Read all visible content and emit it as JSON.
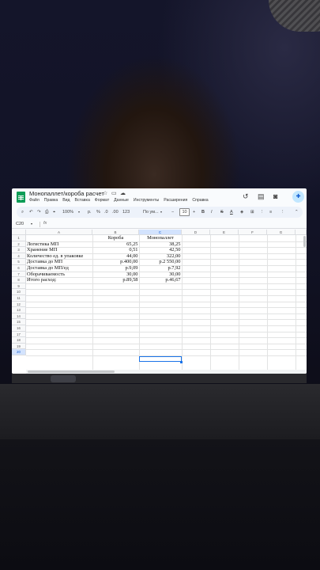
{
  "app": {
    "doc_title": "Монопаллет/короба расчет",
    "menu": [
      "Файл",
      "Правка",
      "Вид",
      "Вставка",
      "Формат",
      "Данные",
      "Инструменты",
      "Расширения",
      "Справка"
    ]
  },
  "toolbar": {
    "zoom": "100%",
    "currency": "р.",
    "percent": "%",
    "decimal_decrease": ".0",
    "decimal_increase": ".00",
    "number_format": "123",
    "font": "По ум...",
    "font_size": "10",
    "bold": "B",
    "italic": "I",
    "strike": "S",
    "text_color": "A"
  },
  "formula_bar": {
    "cell_ref": "C20",
    "fx": "fx"
  },
  "sheet": {
    "columns": [
      "A",
      "B",
      "C",
      "D",
      "E",
      "F",
      "G"
    ],
    "selected_column": "C",
    "row_numbers": [
      "1",
      "2",
      "3",
      "4",
      "5",
      "6",
      "7",
      "8",
      "9",
      "10",
      "11",
      "12",
      "13",
      "14",
      "15",
      "16",
      "17",
      "18",
      "19",
      "20"
    ],
    "selected_row": "20",
    "header": {
      "b": "Короба",
      "c": "Монопаллет"
    },
    "rows": [
      {
        "a": "Логистика МП",
        "b": "65,25",
        "c": "38,25"
      },
      {
        "a": "Хранение МП",
        "b": "0,51",
        "c": "42,50"
      },
      {
        "a": "Количество ед. в упаковке",
        "b": "44,00",
        "c": "322,00"
      },
      {
        "a": "Доставка до МП",
        "b": "р.400,00",
        "c": "р.2 550,00"
      },
      {
        "a": "Доставка до МП/ед",
        "b": "р.9,09",
        "c": "р.7,92"
      },
      {
        "a": "Оборачиваемость",
        "b": "30,00",
        "c": "30,00"
      },
      {
        "a": "Итого расход:",
        "b": "р.89,58",
        "c": "р.46,67"
      }
    ]
  },
  "icons": {
    "star": "star-icon",
    "move": "folder-icon",
    "cloud": "cloud-icon",
    "history": "history-icon",
    "comment": "comment-icon",
    "meet": "video-icon",
    "share": "share-icon"
  },
  "colors": {
    "sheets_green": "#0f9d58",
    "selection_blue": "#1a73e8",
    "toolbar_bg": "#edf2fa"
  }
}
